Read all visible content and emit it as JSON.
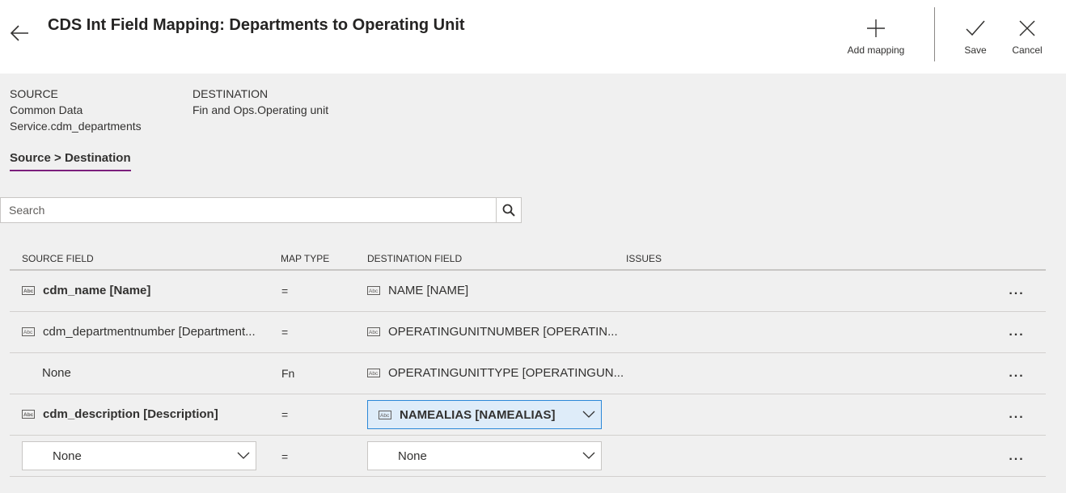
{
  "header": {
    "title": "CDS Int Field Mapping: Departments to Operating Unit",
    "back_icon": "back-arrow-icon",
    "commands": {
      "add_mapping": "Add mapping",
      "save": "Save",
      "cancel": "Cancel"
    }
  },
  "source": {
    "label": "SOURCE",
    "value": "Common Data Service.cdm_departments"
  },
  "destination": {
    "label": "DESTINATION",
    "value": "Fin and Ops.Operating unit"
  },
  "tab": {
    "label": "Source > Destination"
  },
  "search": {
    "placeholder": "Search"
  },
  "table": {
    "columns": {
      "source_field": "SOURCE FIELD",
      "map_type": "MAP TYPE",
      "destination_field": "DESTINATION FIELD",
      "issues": "ISSUES"
    },
    "rows": [
      {
        "source": "cdm_name [Name]",
        "map_type": "=",
        "destination": "NAME [NAME]",
        "more": "..."
      },
      {
        "source": "cdm_departmentnumber [Department...",
        "map_type": "=",
        "destination": "OPERATINGUNITNUMBER [OPERATIN...",
        "more": "..."
      },
      {
        "source": "None",
        "map_type": "Fn",
        "destination": "OPERATINGUNITTYPE [OPERATINGUN...",
        "more": "..."
      },
      {
        "source": "cdm_description [Description]",
        "map_type": "=",
        "destination": "NAMEALIAS [NAMEALIAS]",
        "more": "..."
      },
      {
        "source": "None",
        "map_type": "=",
        "destination": "None",
        "more": "..."
      }
    ]
  },
  "colors": {
    "accent_tab_underline": "#7b1f7c",
    "selected_dropdown_bg": "#deecf9",
    "selected_dropdown_border": "#2b88d8"
  }
}
